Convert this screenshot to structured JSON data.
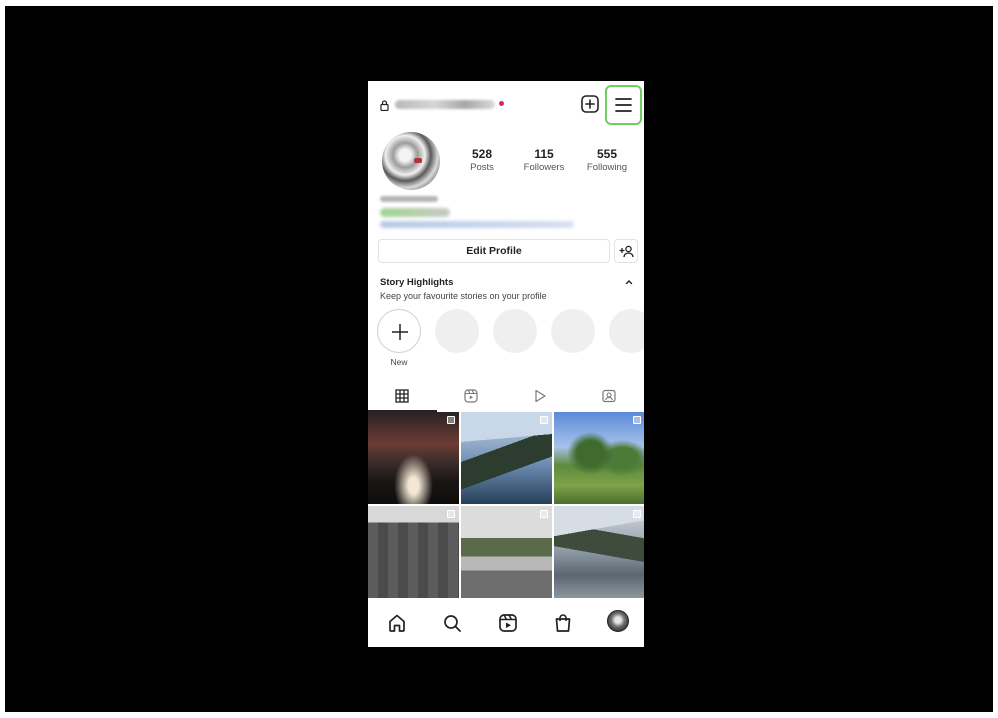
{
  "header": {
    "username": "",
    "new_post_icon": "plus-square-icon",
    "menu_icon": "hamburger-menu-icon"
  },
  "profile": {
    "stats": {
      "posts": {
        "value": "528",
        "label": "Posts"
      },
      "followers": {
        "value": "115",
        "label": "Followers"
      },
      "following": {
        "value": "555",
        "label": "Following"
      }
    },
    "edit_profile_label": "Edit Profile"
  },
  "highlights": {
    "title": "Story Highlights",
    "subtitle": "Keep your favourite stories on your profile",
    "new_label": "New"
  },
  "tabs": [
    {
      "icon": "grid-icon"
    },
    {
      "icon": "reels-icon"
    },
    {
      "icon": "video-play-icon"
    },
    {
      "icon": "tagged-icon"
    }
  ],
  "bottom_nav": [
    {
      "icon": "home-icon"
    },
    {
      "icon": "search-icon"
    },
    {
      "icon": "reels-icon"
    },
    {
      "icon": "shop-icon"
    },
    {
      "icon": "profile-avatar-icon"
    }
  ],
  "colors": {
    "highlight_box": "#6ecf5e",
    "text": "#222222",
    "secondary_text": "#555555",
    "placeholder_circle": "#efefef"
  }
}
